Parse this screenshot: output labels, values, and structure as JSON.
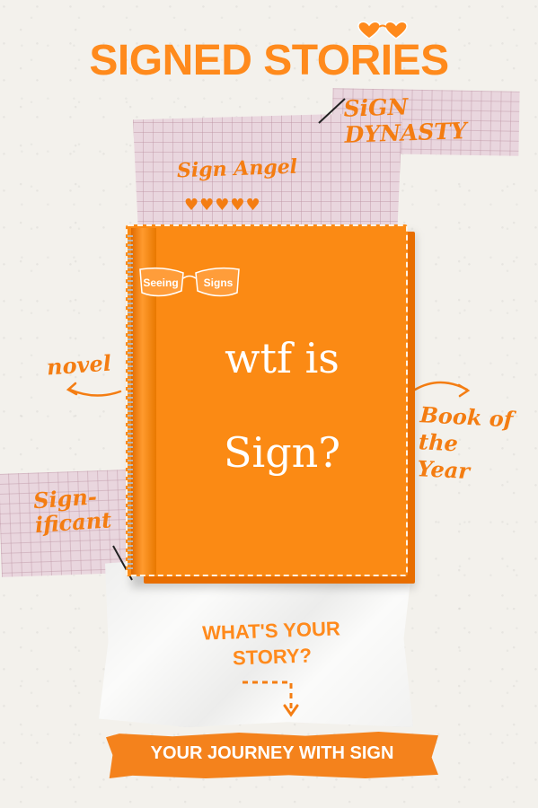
{
  "title": "SIGNED STORIES",
  "labels": {
    "sign_dynasty": "SiGN DYNASTY",
    "sign_angel": "Sign Angel",
    "hearts": "♥♥♥♥♥",
    "novel": "novel",
    "book_of_the_year": "Book of the Year",
    "significant": "Sign-ificant"
  },
  "book": {
    "badge_left": "Seeing",
    "badge_right": "Signs",
    "cover_line1": "wtf is",
    "cover_line2": "Sign?"
  },
  "question": "WHAT'S YOUR STORY?",
  "cta": "YOUR JOURNEY WITH SIGN",
  "colors": {
    "accent": "#ff8a1c",
    "book_orange": "#fb8a14",
    "grid_pink": "#e9d6de",
    "background": "#f3f1ec"
  }
}
